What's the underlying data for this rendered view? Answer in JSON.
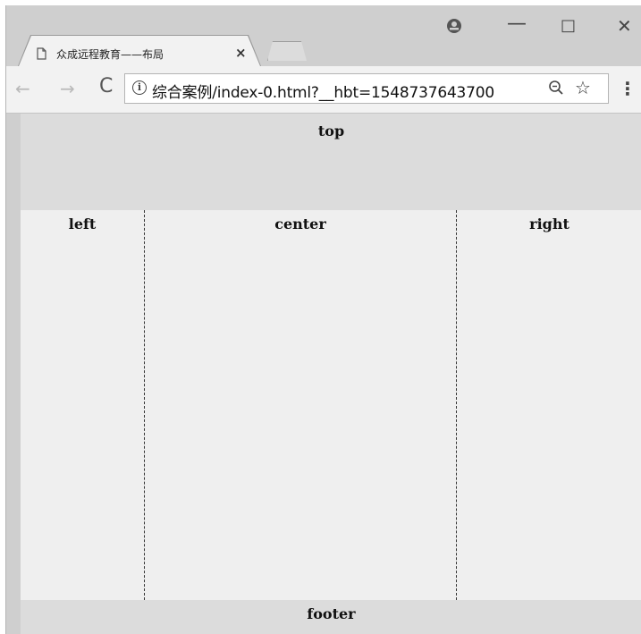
{
  "browser": {
    "tab": {
      "title": "众成远程教育——布局",
      "close_glyph": "×"
    },
    "controls": {
      "profile_glyph": "⊖",
      "minimize_glyph": "—",
      "maximize_glyph": "□",
      "close_glyph": "✕"
    },
    "toolbar": {
      "back_glyph": "←",
      "forward_glyph": "→",
      "reload_glyph": "C",
      "info_glyph": "i",
      "url": "综合案例/index-0.html?__hbt=1548737643700",
      "zoom_glyph": "⊕",
      "star_glyph": "☆",
      "menu_glyph": "⋮"
    }
  },
  "page": {
    "top_label": "top",
    "left_label": "left",
    "center_label": "center",
    "right_label": "right",
    "footer_label": "footer"
  },
  "colors": {
    "frame": "#cfcfcf",
    "toolbar": "#f2f2f2",
    "header_footer": "#dcdcdc",
    "body": "#efefef"
  }
}
